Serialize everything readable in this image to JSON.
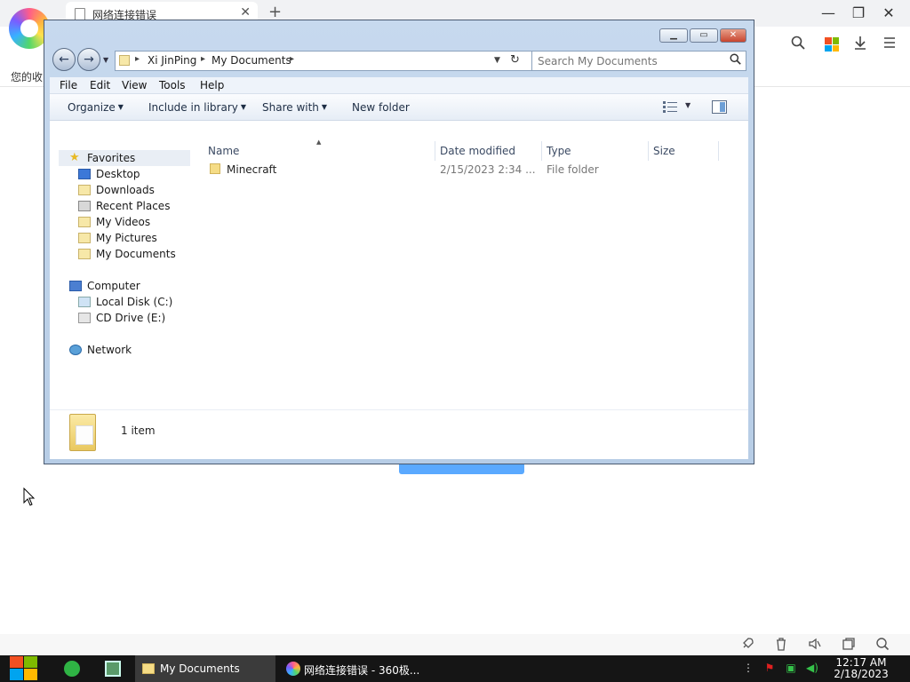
{
  "browser": {
    "tab_title": "网络连接错误",
    "tab_close": "✕",
    "new_tab": "+",
    "minimize": "—",
    "restore": "❐",
    "close": "✕",
    "bookmark_text": "您的收",
    "accent_color": "#5aa9ff"
  },
  "explorer": {
    "address": {
      "crumbs": [
        "Xi JinPing",
        "My Documents"
      ]
    },
    "search_placeholder": "Search My Documents",
    "menu": [
      "File",
      "Edit",
      "View",
      "Tools",
      "Help"
    ],
    "commands": [
      "Organize",
      "Include in library",
      "Share with",
      "New folder"
    ],
    "nav": {
      "favorites": "Favorites",
      "favorites_items": [
        "Desktop",
        "Downloads",
        "Recent Places",
        "My Videos",
        "My Pictures",
        "My Documents"
      ],
      "computer": "Computer",
      "computer_items": [
        "Local Disk (C:)",
        "CD Drive (E:)"
      ],
      "network": "Network"
    },
    "columns": [
      "Name",
      "Date modified",
      "Type",
      "Size"
    ],
    "files": [
      {
        "name": "Minecraft",
        "date": "2/15/2023 2:34 ...",
        "type": "File folder",
        "size": ""
      }
    ],
    "item_count": "1 item"
  },
  "taskbar": {
    "explorer_label": "My Documents",
    "browser_label": "网络连接错误 - 360极...",
    "time": "12:17 AM",
    "date": "2/18/2023"
  }
}
